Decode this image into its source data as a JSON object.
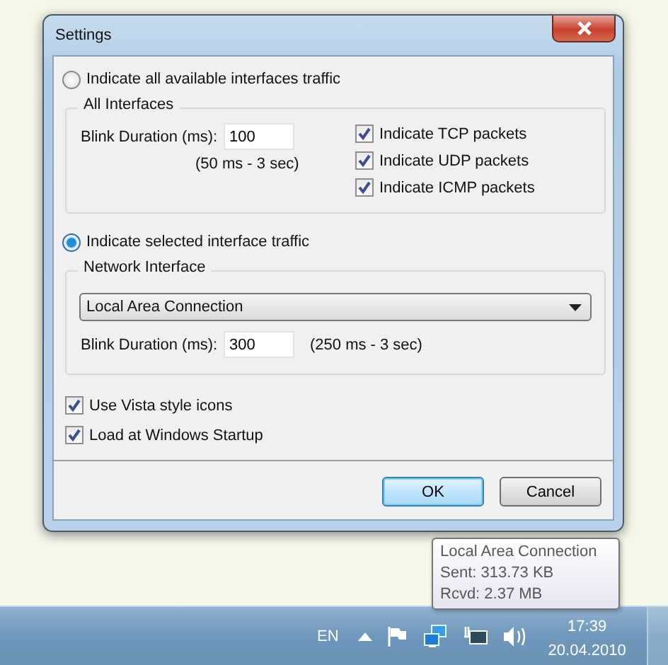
{
  "window": {
    "title": "Settings"
  },
  "all_interfaces": {
    "radio": {
      "label": "Indicate all available interfaces traffic",
      "selected": false
    },
    "group_title": "All Interfaces",
    "blink_label": "Blink Duration (ms):",
    "blink_value": "100",
    "range": "(50 ms - 3 sec)",
    "packet_options": [
      {
        "label": "Indicate TCP packets",
        "checked": true
      },
      {
        "label": "Indicate UDP packets",
        "checked": true
      },
      {
        "label": "Indicate ICMP packets",
        "checked": true
      }
    ]
  },
  "selected_interface": {
    "radio": {
      "label": "Indicate selected interface traffic",
      "selected": true
    },
    "group_title": "Network Interface",
    "interface": "Local Area Connection",
    "blink_label": "Blink Duration (ms):",
    "blink_value": "300",
    "range": "(250 ms - 3 sec)"
  },
  "options": [
    {
      "label": "Use Vista style icons",
      "checked": true
    },
    {
      "label": "Load at Windows Startup",
      "checked": true
    }
  ],
  "buttons": [
    {
      "label": "OK",
      "default": true
    },
    {
      "label": "Cancel",
      "default": false
    }
  ],
  "tooltip": {
    "lines": [
      "Local Area Connection",
      "Sent: 313.73 KB",
      "Rcvd: 2.37 MB"
    ]
  },
  "taskbar": {
    "language": "EN",
    "time": "17:39",
    "date": "20.04.2010"
  }
}
